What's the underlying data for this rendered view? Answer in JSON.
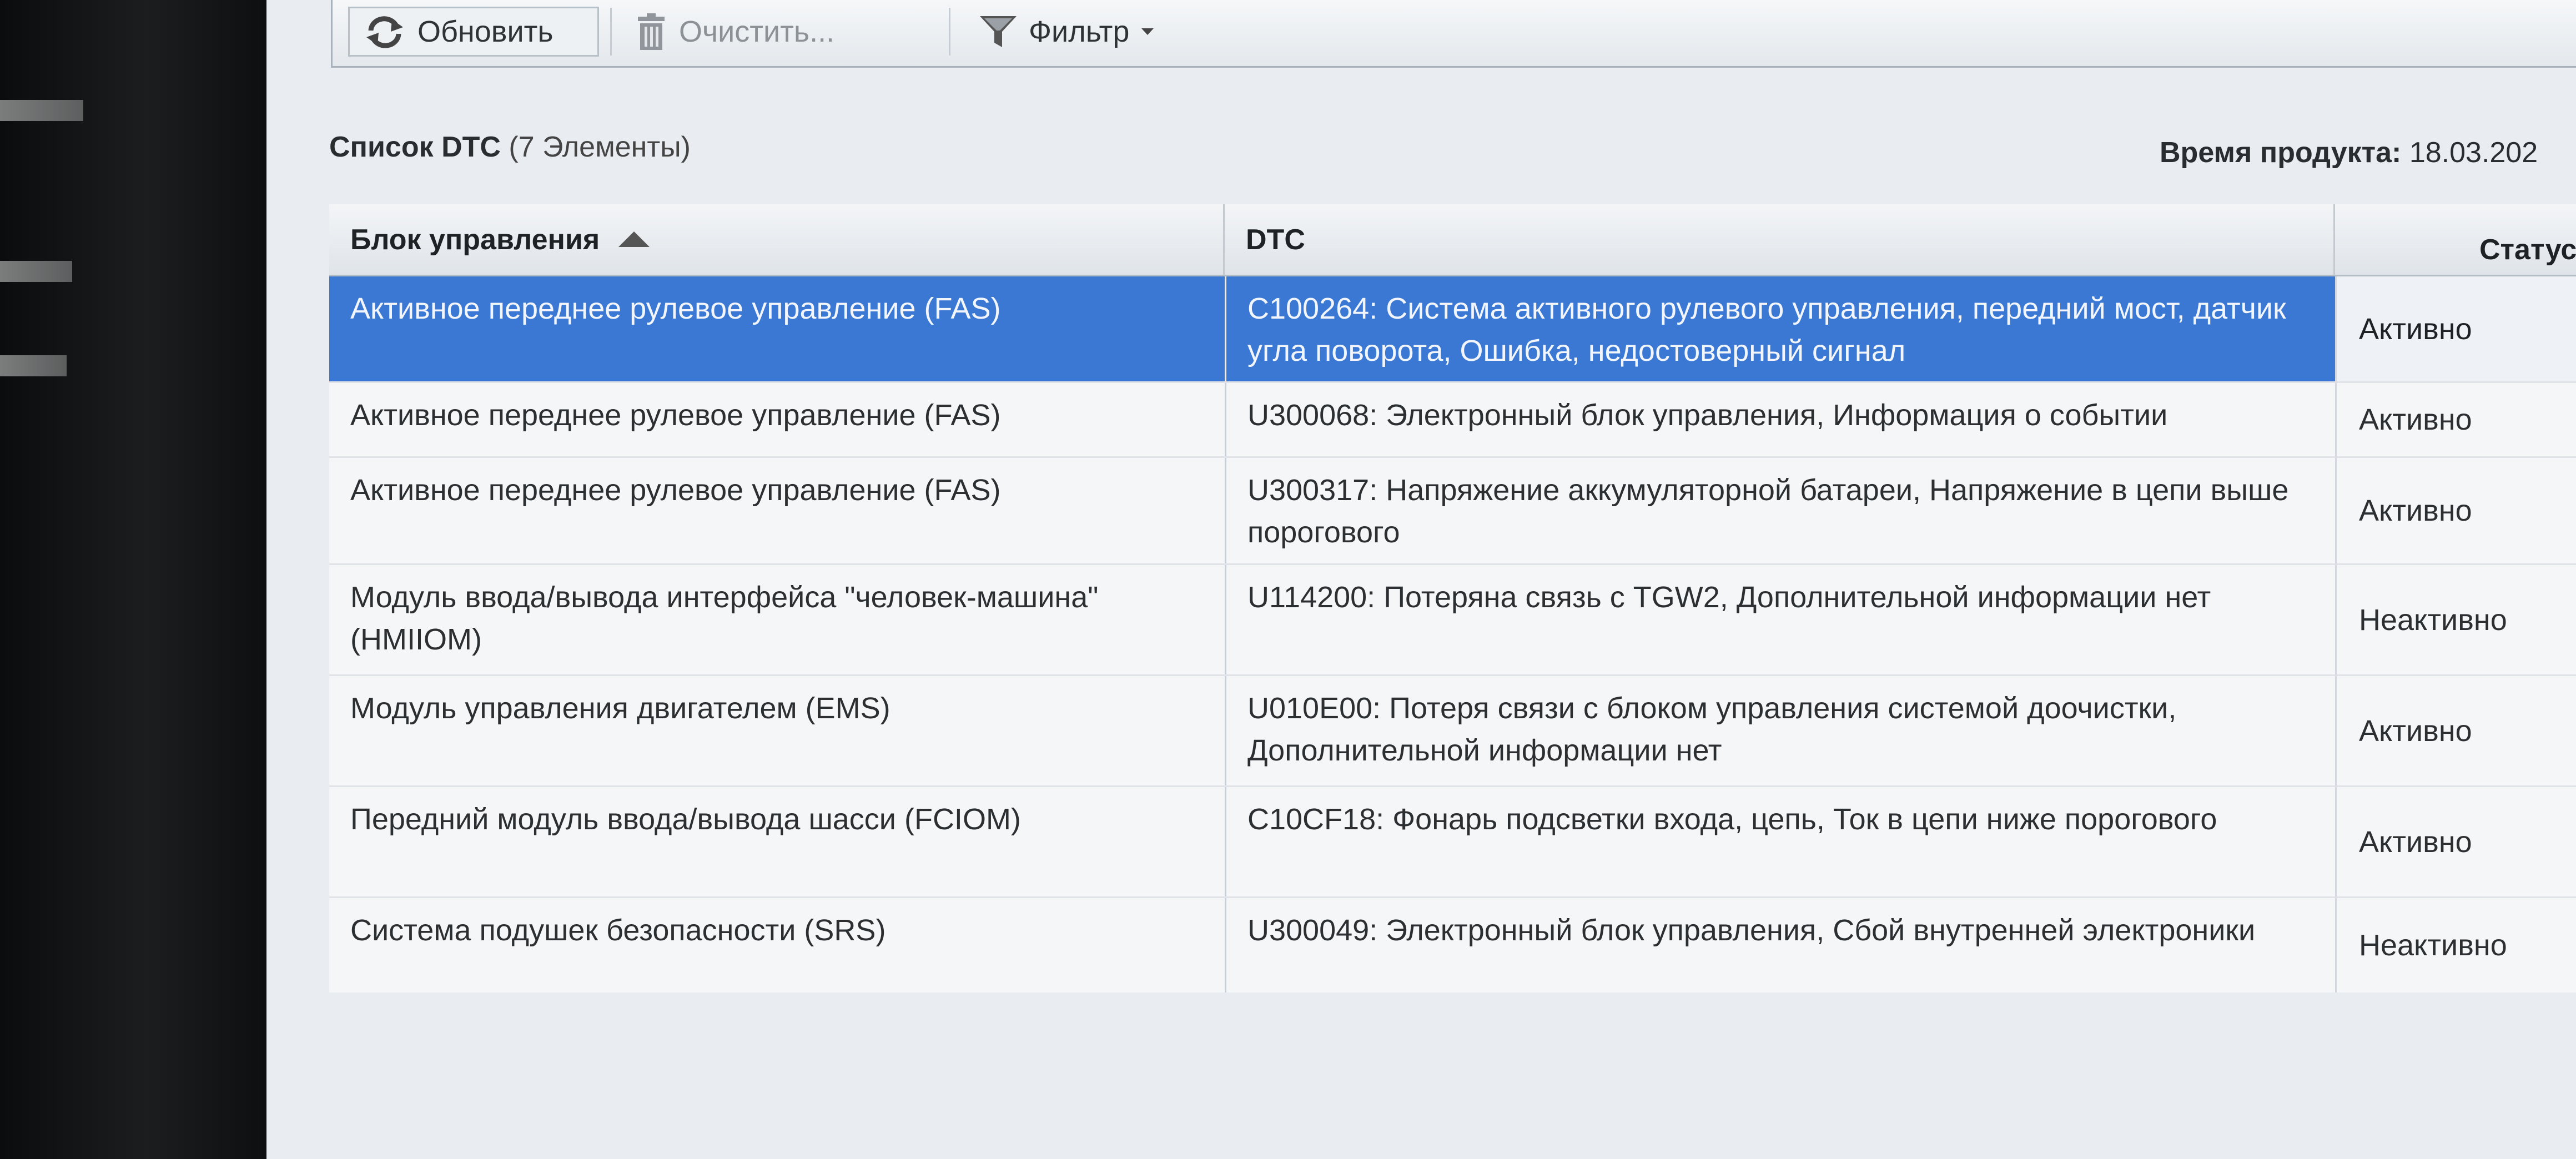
{
  "toolbar": {
    "refresh_label": "Обновить",
    "clear_label": "Очистить...",
    "filter_label": "Фильтр"
  },
  "list": {
    "title": "Список DTC",
    "count": "(7 Элементы)"
  },
  "product_time": {
    "label": "Время продукта:",
    "value": "18.03.202"
  },
  "table": {
    "columns": [
      "Блок управления",
      "DTC",
      "Статус"
    ],
    "rows": [
      {
        "unit": "Активное переднее рулевое управление (FAS)",
        "dtc": "C100264: Система активного рулевого управления, передний мост, датчик угла поворота, Ошибка, недостоверный сигнал",
        "status": "Активно"
      },
      {
        "unit": "Активное переднее рулевое управление (FAS)",
        "dtc": "U300068: Электронный блок управления, Информация о событии",
        "status": "Активно"
      },
      {
        "unit": "Активное переднее рулевое управление (FAS)",
        "dtc": "U300317: Напряжение аккумуляторной батареи, Напряжение в цепи выше порогового",
        "status": "Активно"
      },
      {
        "unit": "Модуль ввода/вывода интерфейса \"человек-машина\" (HMIIOM)",
        "dtc": "U114200: Потеряна связь с TGW2, Дополнительной информации нет",
        "status": "Неактивно"
      },
      {
        "unit": "Модуль управления двигателем (EMS)",
        "dtc": "U010E00: Потеря связи с блоком управления системой доочистки, Дополнительной информации нет",
        "status": "Активно"
      },
      {
        "unit": "Передний модуль ввода/вывода шасси (FCIOM)",
        "dtc": "C10CF18: Фонарь подсветки входа, цепь, Ток в цепи ниже порогового",
        "status": "Активно"
      },
      {
        "unit": "Система подушек безопасности (SRS)",
        "dtc": "U300049: Электронный блок управления, Сбой внутренней электроники",
        "status": "Неактивно"
      }
    ],
    "selected_row": 0
  },
  "colors": {
    "selection": "#3a78d4",
    "screen_bg": "#e9edf1"
  },
  "icons": {
    "refresh": "refresh-arrows-icon",
    "clear": "trash-icon",
    "filter": "funnel-icon",
    "filter_menu": "caret-down-icon",
    "sort": "sort-ascending-icon"
  }
}
